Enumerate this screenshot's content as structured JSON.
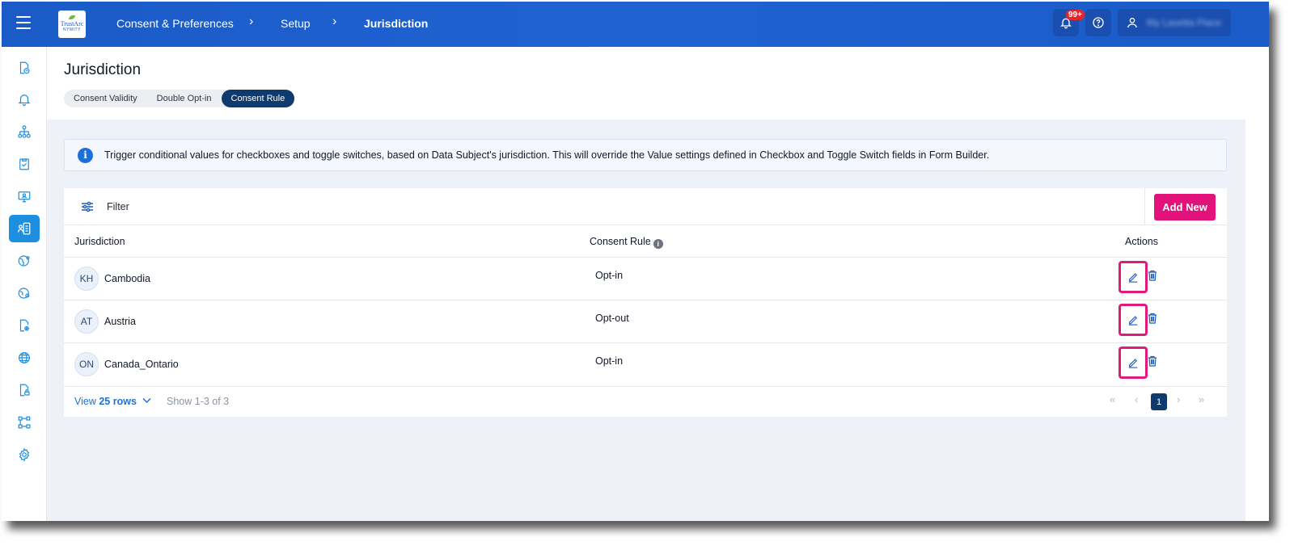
{
  "header": {
    "logo": {
      "line1": "TrustArc",
      "line2": "NYMITY"
    },
    "breadcrumb": [
      "Consent & Preferences",
      "Setup",
      "Jurisdiction"
    ],
    "notifications_badge": "99+",
    "user_name": "My Lasetta Place"
  },
  "sidebar": {
    "icons": [
      "document-clock-icon",
      "bell-icon",
      "hierarchy-icon",
      "clipboard-check-icon",
      "monitor-user-icon",
      "form-user-icon",
      "globe-user-icon",
      "globe-user-alt-icon",
      "document-settings-icon",
      "globe-icon",
      "document-lock-icon",
      "workflow-icon",
      "gear-icon"
    ],
    "active_index": 5
  },
  "page": {
    "title": "Jurisdiction",
    "tabs": [
      {
        "label": "Consent Validity",
        "active": false
      },
      {
        "label": "Double Opt-in",
        "active": false
      },
      {
        "label": "Consent Rule",
        "active": true
      }
    ],
    "info": "Trigger conditional values for checkboxes and toggle switches, based on Data Subject's jurisdiction. This will override the Value settings defined in Checkbox and Toggle Switch fields in Form Builder."
  },
  "table": {
    "filter_label": "Filter",
    "add_button": "Add New",
    "columns": {
      "jurisdiction": "Jurisdiction",
      "consent_rule": "Consent Rule",
      "actions": "Actions"
    },
    "rows": [
      {
        "code": "KH",
        "name": "Cambodia",
        "rule": "Opt-in"
      },
      {
        "code": "AT",
        "name": "Austria",
        "rule": "Opt-out"
      },
      {
        "code": "ON",
        "name": "Canada_Ontario",
        "rule": "Opt-in"
      }
    ]
  },
  "pagination": {
    "view_prefix": "View",
    "rows_per_page": "25 rows",
    "range": "Show 1-3 of 3",
    "current_page": "1"
  },
  "colors": {
    "header_blue": "#1f62d2",
    "accent_pink": "#e3117a",
    "navy": "#0e3a6e",
    "sidebar_active": "#1d8fe0"
  }
}
